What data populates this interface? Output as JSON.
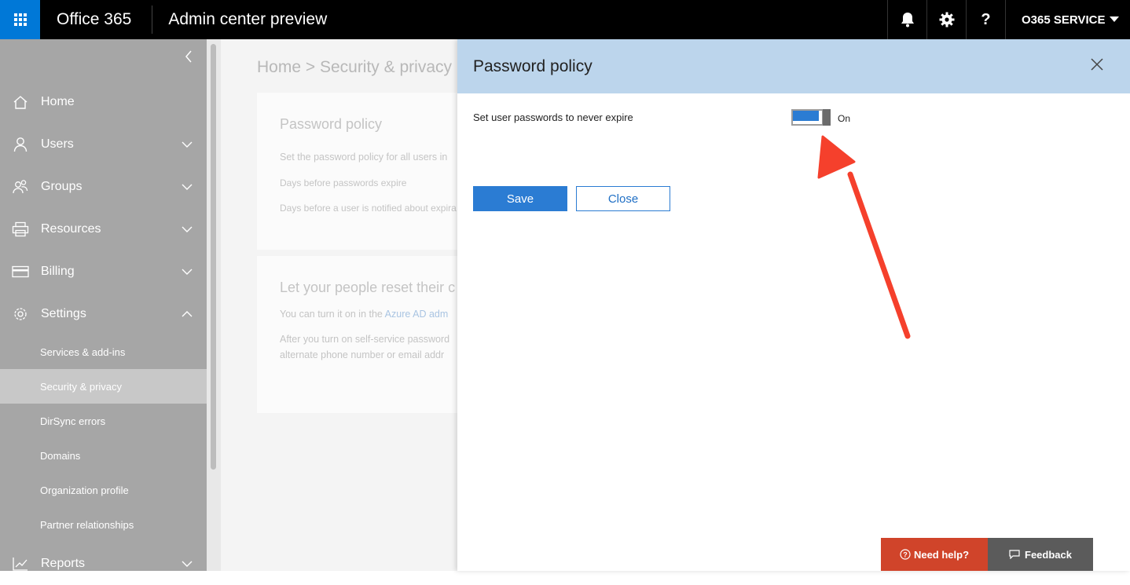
{
  "topbar": {
    "brand": "Office 365",
    "app_title": "Admin center preview",
    "account": "O365 SERVICE"
  },
  "sidebar": {
    "items": [
      {
        "label": "Home",
        "icon": "home-icon"
      },
      {
        "label": "Users",
        "icon": "user-icon"
      },
      {
        "label": "Groups",
        "icon": "groups-icon"
      },
      {
        "label": "Resources",
        "icon": "printer-icon"
      },
      {
        "label": "Billing",
        "icon": "card-icon"
      },
      {
        "label": "Settings",
        "icon": "gear-icon"
      }
    ],
    "sub_items": [
      {
        "label": "Services & add-ins"
      },
      {
        "label": "Security & privacy",
        "active": true
      },
      {
        "label": "DirSync errors"
      },
      {
        "label": "Domains"
      },
      {
        "label": "Organization profile"
      },
      {
        "label": "Partner relationships"
      }
    ],
    "reports": {
      "label": "Reports",
      "icon": "chart-icon"
    }
  },
  "background": {
    "breadcrumb": "Home > Security & privacy",
    "card1": {
      "title": "Password policy",
      "line1": "Set the password policy for all users in",
      "line2": "Days before passwords expire",
      "line3": "Days before a user is notified about expira"
    },
    "card2": {
      "title": "Let your people reset their c",
      "line1_pre": "You can turn it on in the ",
      "line1_link": "Azure AD adm",
      "line2": "After you turn on self-service password",
      "line3": "alternate phone number or email addr"
    }
  },
  "panel": {
    "title": "Password policy",
    "setting_label": "Set user passwords to never expire",
    "toggle_state": "On",
    "toggle_on": true,
    "save_label": "Save",
    "close_label": "Close"
  },
  "footer": {
    "need_help": "Need help?",
    "feedback": "Feedback"
  },
  "colors": {
    "accent": "#0078d7",
    "toggle_blue": "#2b7cd3",
    "panel_header": "#bcd5ec",
    "need_help": "#d0442a",
    "annotation_arrow": "#f5402c"
  }
}
